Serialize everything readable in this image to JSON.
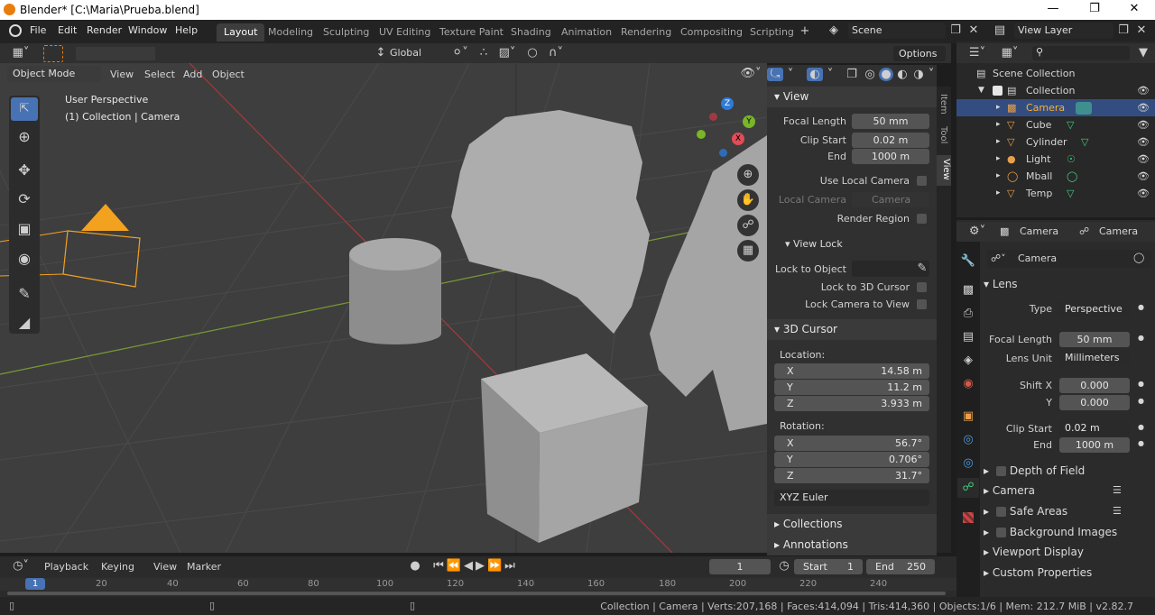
{
  "window": {
    "title": "Blender* [C:\\Maria\\Prueba.blend]",
    "min": "—",
    "max": "❐",
    "close": "✕"
  },
  "menu": [
    "File",
    "Edit",
    "Render",
    "Window",
    "Help"
  ],
  "workspaces": [
    "Layout",
    "Modeling",
    "Sculpting",
    "UV Editing",
    "Texture Paint",
    "Shading",
    "Animation",
    "Rendering",
    "Compositing",
    "Scripting"
  ],
  "scene": "Scene",
  "view_layer": "View Layer",
  "viewport": {
    "mode": "Object Mode",
    "menus": [
      "View",
      "Select",
      "Add",
      "Object"
    ],
    "transform": "Global",
    "options": "Options",
    "overlay_line1": "User Perspective",
    "overlay_line2": "(1) Collection | Camera",
    "gizmo": {
      "x": "X",
      "y": "Y",
      "z": "Z"
    }
  },
  "npanel": {
    "tabs": [
      "Item",
      "Tool",
      "View"
    ],
    "view_header": "View",
    "focal_length_label": "Focal Length",
    "focal_length": "50 mm",
    "clip_start_label": "Clip Start",
    "clip_start": "0.02 m",
    "end_label": "End",
    "end": "1000 m",
    "use_local_camera": "Use Local Camera",
    "local_camera_label": "Local Camera",
    "local_camera": "Camera",
    "render_region": "Render Region",
    "view_lock_header": "View Lock",
    "lock_to_object": "Lock to Object",
    "lock_to_cursor": "Lock to 3D Cursor",
    "lock_camera": "Lock Camera to View",
    "cursor_header": "3D Cursor",
    "location_label": "Location:",
    "loc": [
      {
        "axis": "X",
        "val": "14.58 m"
      },
      {
        "axis": "Y",
        "val": "11.2 m"
      },
      {
        "axis": "Z",
        "val": "3.933 m"
      }
    ],
    "rotation_label": "Rotation:",
    "rot": [
      {
        "axis": "X",
        "val": "56.7°"
      },
      {
        "axis": "Y",
        "val": "0.706°"
      },
      {
        "axis": "Z",
        "val": "31.7°"
      }
    ],
    "rot_mode": "XYZ Euler",
    "collections": "Collections",
    "annotations": "Annotations"
  },
  "outliner": {
    "root": "Scene Collection",
    "collection": "Collection",
    "items": [
      "Camera",
      "Cube",
      "Cylinder",
      "Light",
      "Mball",
      "Temp"
    ]
  },
  "properties": {
    "tab1": "Camera",
    "tab2": "Camera",
    "datablock": "Camera",
    "lens_header": "Lens",
    "type_label": "Type",
    "type": "Perspective",
    "focal_label": "Focal Length",
    "focal": "50 mm",
    "unit_label": "Lens Unit",
    "unit": "Millimeters",
    "shiftx_label": "Shift X",
    "shiftx": "0.000",
    "y_label": "Y",
    "shifty": "0.000",
    "clipstart_label": "Clip Start",
    "clipstart": "0.02 m",
    "end_label": "End",
    "end": "1000 m",
    "panels": [
      "Depth of Field",
      "Camera",
      "Safe Areas",
      "Background Images",
      "Viewport Display",
      "Custom Properties"
    ]
  },
  "timeline": {
    "menus": [
      "Playback",
      "Keying",
      "View",
      "Marker"
    ],
    "current": "1",
    "start_label": "Start",
    "start": "1",
    "end_label": "End",
    "end": "250",
    "ticks": [
      "1",
      "20",
      "40",
      "60",
      "80",
      "100",
      "120",
      "140",
      "160",
      "180",
      "200",
      "220",
      "240"
    ]
  },
  "status": "Collection | Camera | Verts:207,168 | Faces:414,094 | Tris:414,360 | Objects:1/6 | Mem: 212.7 MiB | v2.82.7",
  "colors": {
    "accent": "#4772b3",
    "orange": "#e87d0d",
    "viewport_bg": "#3e3e3e"
  }
}
